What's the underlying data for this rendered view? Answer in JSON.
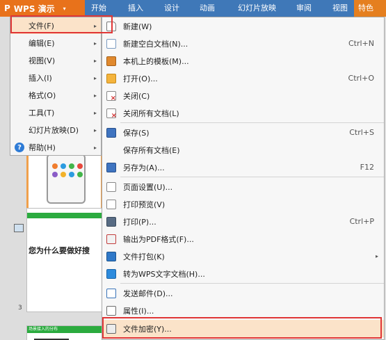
{
  "app": {
    "logo_glyph": "P",
    "title": "WPS 演示",
    "dropdown_glyph": "▾"
  },
  "ribbon_tabs": [
    "开始",
    "插入",
    "设计",
    "动画",
    "幻灯片放映",
    "审阅",
    "视图"
  ],
  "accent_tab": "特色",
  "main_menu": {
    "items": [
      {
        "label": "文件(F)",
        "has_arrow": true
      },
      {
        "label": "编辑(E)",
        "has_arrow": true
      },
      {
        "label": "视图(V)",
        "has_arrow": true
      },
      {
        "label": "插入(I)",
        "has_arrow": true
      },
      {
        "label": "格式(O)",
        "has_arrow": true
      },
      {
        "label": "工具(T)",
        "has_arrow": true
      },
      {
        "label": "幻灯片放映(D)",
        "has_arrow": true
      },
      {
        "label": "帮助(H)",
        "has_arrow": true
      }
    ],
    "help_glyph": "?"
  },
  "submenu": {
    "arrow_glyph": "▸",
    "items": [
      {
        "icon": "new-document-icon",
        "label": "新建(W)",
        "shortcut": ""
      },
      {
        "icon": "blank-document-icon",
        "label": "新建空白文档(N)...",
        "shortcut": "Ctrl+N"
      },
      {
        "icon": "template-icon",
        "label": "本机上的模板(M)...",
        "shortcut": ""
      },
      {
        "icon": "open-folder-icon",
        "label": "打开(O)...",
        "shortcut": "Ctrl+O"
      },
      {
        "icon": "close-document-icon",
        "label": "关闭(C)",
        "shortcut": ""
      },
      {
        "icon": "close-all-documents-icon",
        "label": "关闭所有文档(L)",
        "shortcut": ""
      },
      {
        "icon": "save-icon",
        "label": "保存(S)",
        "shortcut": "Ctrl+S"
      },
      {
        "icon": "",
        "label": "保存所有文档(E)",
        "shortcut": ""
      },
      {
        "icon": "save-as-icon",
        "label": "另存为(A)...",
        "shortcut": "F12"
      },
      {
        "icon": "page-setup-icon",
        "label": "页面设置(U)...",
        "shortcut": ""
      },
      {
        "icon": "print-preview-icon",
        "label": "打印预览(V)",
        "shortcut": ""
      },
      {
        "icon": "printer-icon",
        "label": "打印(P)...",
        "shortcut": "Ctrl+P"
      },
      {
        "icon": "pdf-export-icon",
        "label": "输出为PDF格式(F)...",
        "shortcut": ""
      },
      {
        "icon": "package-icon",
        "label": "文件打包(K)",
        "shortcut": "",
        "submenu": true
      },
      {
        "icon": "convert-to-wps-writer-icon",
        "label": "转为WPS文字文档(H)...",
        "shortcut": ""
      },
      {
        "icon": "send-mail-icon",
        "label": "发送邮件(D)...",
        "shortcut": ""
      },
      {
        "icon": "properties-icon",
        "label": "属性(I)...",
        "shortcut": ""
      },
      {
        "icon": "encrypt-file-icon",
        "label": "文件加密(Y)...",
        "shortcut": ""
      }
    ]
  },
  "background": {
    "slide_numbers": [
      "3"
    ],
    "slide2_headline": "您为什么要做好搜",
    "slide3_header": "场景接入的分布"
  },
  "colors": {
    "ribbon_blue": "#3f78b8",
    "wps_orange": "#e8721b",
    "highlight_red": "#e03636",
    "selected_fill": "#fbe3c9"
  }
}
